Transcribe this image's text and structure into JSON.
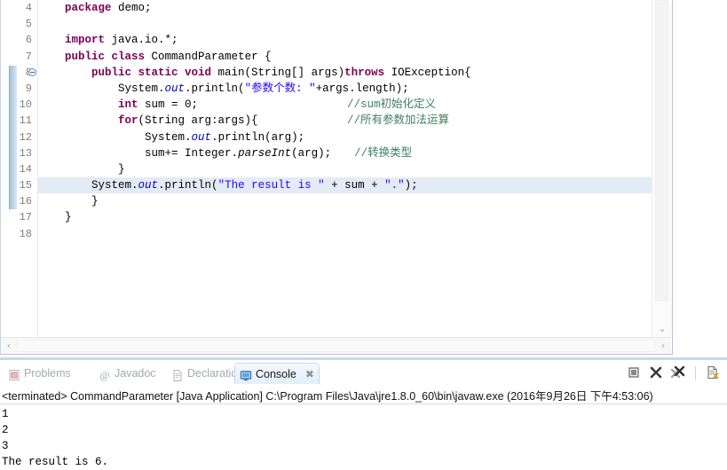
{
  "editor": {
    "highlighted_line": 15,
    "scope_marker_from": 8,
    "scope_marker_to": 16,
    "fold_marker_line": 8,
    "colors": {
      "keyword": "#7F0055",
      "string": "#2A00FF",
      "comment": "#3F7F5F",
      "field": "#0000C0",
      "line_number": "#808080",
      "highlight_bg": "#E3EBF7"
    },
    "lines": [
      {
        "num": "4",
        "indent": 1,
        "tokens": [
          {
            "t": "package ",
            "c": "kw"
          },
          {
            "t": "demo;",
            "c": "pl"
          }
        ]
      },
      {
        "num": "5",
        "indent": 0,
        "tokens": []
      },
      {
        "num": "6",
        "indent": 1,
        "tokens": [
          {
            "t": "import ",
            "c": "kw"
          },
          {
            "t": "java.io.*;",
            "c": "pl"
          }
        ]
      },
      {
        "num": "7",
        "indent": 1,
        "tokens": [
          {
            "t": "public class ",
            "c": "kw"
          },
          {
            "t": "CommandParameter {",
            "c": "pl"
          }
        ]
      },
      {
        "num": "8",
        "indent": 2,
        "tokens": [
          {
            "t": "public static void ",
            "c": "kw"
          },
          {
            "t": "main(String[] args)",
            "c": "pl"
          },
          {
            "t": "throws ",
            "c": "kw"
          },
          {
            "t": "IOException{",
            "c": "pl"
          }
        ]
      },
      {
        "num": "9",
        "indent": 3,
        "tokens": [
          {
            "t": "System.",
            "c": "pl"
          },
          {
            "t": "out",
            "c": "fld"
          },
          {
            "t": ".println(",
            "c": "pl"
          },
          {
            "t": "\"参数个数: \"",
            "c": "str"
          },
          {
            "t": "+args.length);",
            "c": "pl"
          }
        ]
      },
      {
        "num": "10",
        "indent": 3,
        "tokens": [
          {
            "t": "int ",
            "c": "kw"
          },
          {
            "t": "sum = 0;",
            "c": "pl"
          }
        ],
        "comment": "//sum初始化定义"
      },
      {
        "num": "11",
        "indent": 3,
        "tokens": [
          {
            "t": "for",
            "c": "kw"
          },
          {
            "t": "(String arg:args){",
            "c": "pl"
          }
        ],
        "comment": "//所有参数加法运算"
      },
      {
        "num": "12",
        "indent": 4,
        "tokens": [
          {
            "t": "System.",
            "c": "pl"
          },
          {
            "t": "out",
            "c": "fld"
          },
          {
            "t": ".println(arg);",
            "c": "pl"
          }
        ]
      },
      {
        "num": "13",
        "indent": 4,
        "tokens": [
          {
            "t": "sum+= Integer.",
            "c": "pl"
          },
          {
            "t": "parseInt",
            "c": "stc"
          },
          {
            "t": "(arg);",
            "c": "pl"
          }
        ],
        "comment": "//转换类型",
        "comment_inline": true
      },
      {
        "num": "14",
        "indent": 3,
        "tokens": [
          {
            "t": "}",
            "c": "pl"
          }
        ]
      },
      {
        "num": "15",
        "indent": 2,
        "tokens": [
          {
            "t": "System.",
            "c": "pl"
          },
          {
            "t": "out",
            "c": "fld"
          },
          {
            "t": ".println(",
            "c": "pl"
          },
          {
            "t": "\"The result is \"",
            "c": "str"
          },
          {
            "t": " + sum + ",
            "c": "pl"
          },
          {
            "t": "\".\"",
            "c": "str"
          },
          {
            "t": ");",
            "c": "pl"
          }
        ]
      },
      {
        "num": "16",
        "indent": 2,
        "tokens": [
          {
            "t": "}",
            "c": "pl"
          }
        ]
      },
      {
        "num": "17",
        "indent": 1,
        "tokens": [
          {
            "t": "}",
            "c": "pl"
          }
        ]
      },
      {
        "num": "18",
        "indent": 0,
        "tokens": []
      }
    ]
  },
  "scrollbars": {
    "v_arrow_down": "⌄",
    "h_arrow_left": "‹",
    "h_arrow_right": "›"
  },
  "panel": {
    "tabs": [
      {
        "id": "problems",
        "label": "Problems",
        "icon": "problems-icon",
        "active": false,
        "closable": false
      },
      {
        "id": "javadoc",
        "label": "Javadoc",
        "icon": "javadoc-icon",
        "active": false,
        "closable": false
      },
      {
        "id": "declaration",
        "label": "Declaration",
        "icon": "declaration-icon",
        "active": false,
        "closable": false
      },
      {
        "id": "console",
        "label": "Console",
        "icon": "console-icon",
        "active": true,
        "closable": true
      }
    ],
    "close_glyph": "✖",
    "toolbar": [
      {
        "id": "terminate",
        "name": "terminate-button"
      },
      {
        "id": "remove-launch",
        "name": "remove-launch-button"
      },
      {
        "id": "remove-all-terminated",
        "name": "remove-all-terminated-button"
      },
      {
        "id": "clear-console",
        "name": "clear-console-button"
      }
    ],
    "status": "<terminated> CommandParameter [Java Application] C:\\Program Files\\Java\\jre1.8.0_60\\bin\\javaw.exe (2016年9月26日 下午4:53:06)",
    "output": "1\n2\n3\nThe result is 6."
  }
}
